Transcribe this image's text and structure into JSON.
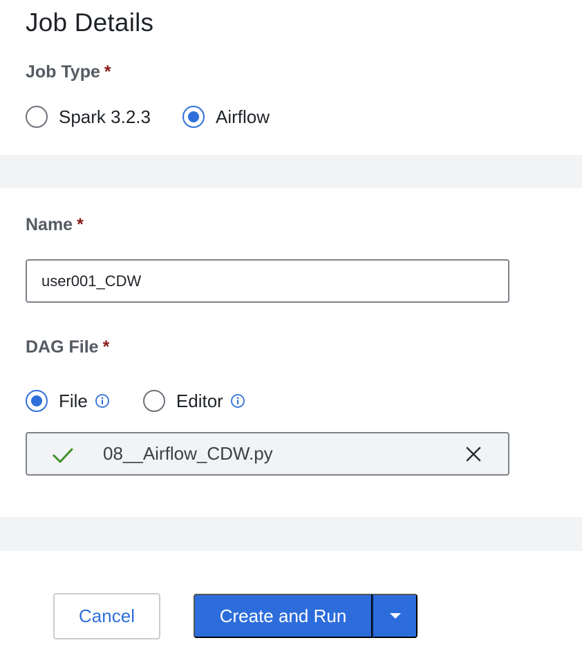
{
  "page_title": "Job Details",
  "job_type": {
    "label": "Job Type",
    "required_mark": "*",
    "options": [
      {
        "label": "Spark 3.2.3",
        "selected": false
      },
      {
        "label": "Airflow",
        "selected": true
      }
    ]
  },
  "name": {
    "label": "Name",
    "required_mark": "*",
    "value": "user001_CDW"
  },
  "dag_file": {
    "label": "DAG File",
    "required_mark": "*",
    "options": [
      {
        "label": "File",
        "selected": true,
        "icon": "info-icon"
      },
      {
        "label": "Editor",
        "selected": false,
        "icon": "info-icon"
      }
    ],
    "uploaded_file": "08__Airflow_CDW.py",
    "status_icon": "check-icon",
    "remove_icon": "close-icon"
  },
  "actions": {
    "cancel_label": "Cancel",
    "primary_label": "Create and Run",
    "split_icon": "caret-down-icon"
  },
  "colors": {
    "accent": "#2d6ddb",
    "required": "#8b1a1a",
    "success": "#3f8f2a",
    "band": "#f2f3f5"
  }
}
